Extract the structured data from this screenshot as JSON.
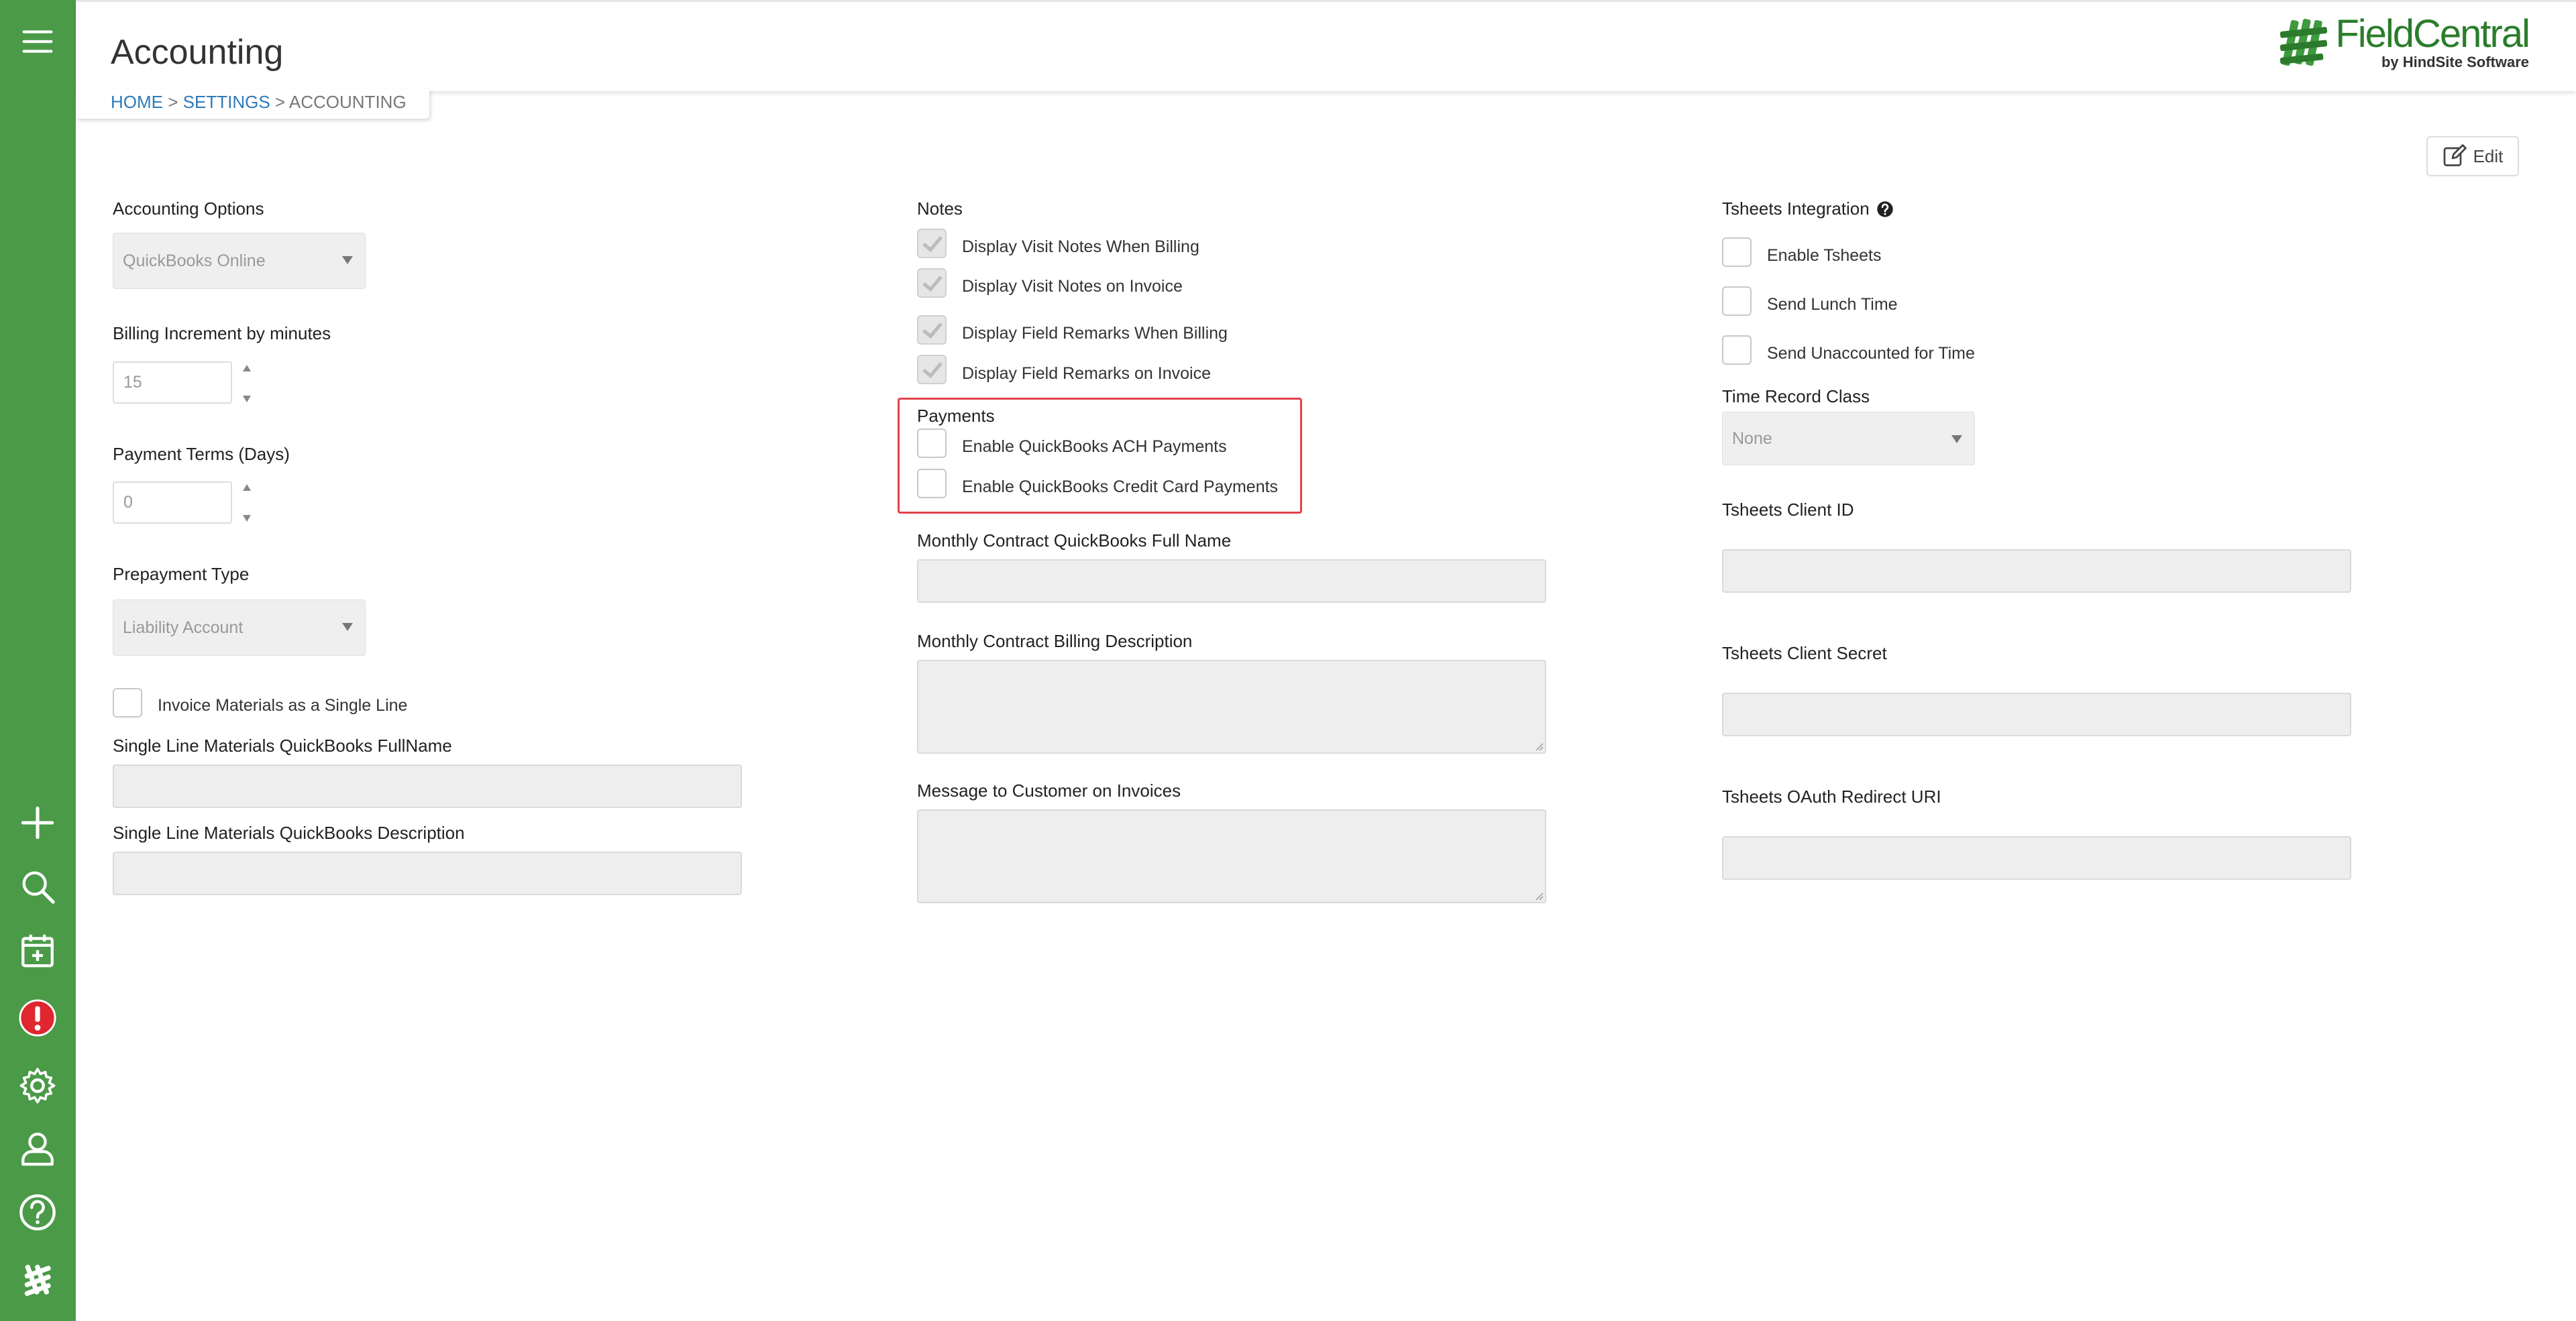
{
  "app": {
    "name": "FieldCentral",
    "tagline": "by HindSite Software"
  },
  "page": {
    "title": "Accounting"
  },
  "breadcrumb": {
    "home": "HOME",
    "sep": ">",
    "settings": "SETTINGS",
    "current": "ACCOUNTING"
  },
  "toolbar": {
    "edit_label": "Edit"
  },
  "sidebar": {
    "icons": [
      "menu-icon",
      "plus-icon",
      "search-icon",
      "calendar-add-icon",
      "alert-icon",
      "gear-icon",
      "user-icon",
      "help-icon",
      "logo-icon"
    ]
  },
  "left": {
    "accounting_options_label": "Accounting Options",
    "accounting_options_value": "QuickBooks Online",
    "billing_increment_label": "Billing Increment by minutes",
    "billing_increment_value": "15",
    "payment_terms_label": "Payment Terms (Days)",
    "payment_terms_value": "0",
    "prepayment_type_label": "Prepayment Type",
    "prepayment_type_value": "Liability Account",
    "invoice_single_line_label": "Invoice Materials as a Single Line",
    "single_line_fullname_label": "Single Line Materials QuickBooks FullName",
    "single_line_description_label": "Single Line Materials QuickBooks Description"
  },
  "middle": {
    "notes_label": "Notes",
    "notes": [
      {
        "label": "Display Visit Notes When Billing",
        "checked": true
      },
      {
        "label": "Display Visit Notes on Invoice",
        "checked": true
      },
      {
        "label": "Display Field Remarks When Billing",
        "checked": true
      },
      {
        "label": "Display Field Remarks on Invoice",
        "checked": true
      }
    ],
    "payments_label": "Payments",
    "payments": [
      {
        "label": "Enable QuickBooks ACH Payments",
        "checked": false
      },
      {
        "label": "Enable QuickBooks Credit Card Payments",
        "checked": false
      }
    ],
    "monthly_fullname_label": "Monthly Contract QuickBooks Full Name",
    "monthly_billing_desc_label": "Monthly Contract Billing Description",
    "message_label": "Message to Customer on Invoices"
  },
  "right": {
    "tsheets_label": "Tsheets Integration",
    "tsheets": [
      {
        "label": "Enable Tsheets",
        "checked": false
      },
      {
        "label": "Send Lunch Time",
        "checked": false
      },
      {
        "label": "Send Unaccounted for Time",
        "checked": false
      }
    ],
    "time_record_class_label": "Time Record Class",
    "time_record_class_value": "None",
    "client_id_label": "Tsheets Client ID",
    "client_secret_label": "Tsheets Client Secret",
    "oauth_label": "Tsheets OAuth Redirect URI"
  },
  "colors": {
    "sidebar": "#4a9a48",
    "accent_link": "#2e7ab8",
    "highlight_border": "#e0444c",
    "alert": "#e0262f"
  }
}
